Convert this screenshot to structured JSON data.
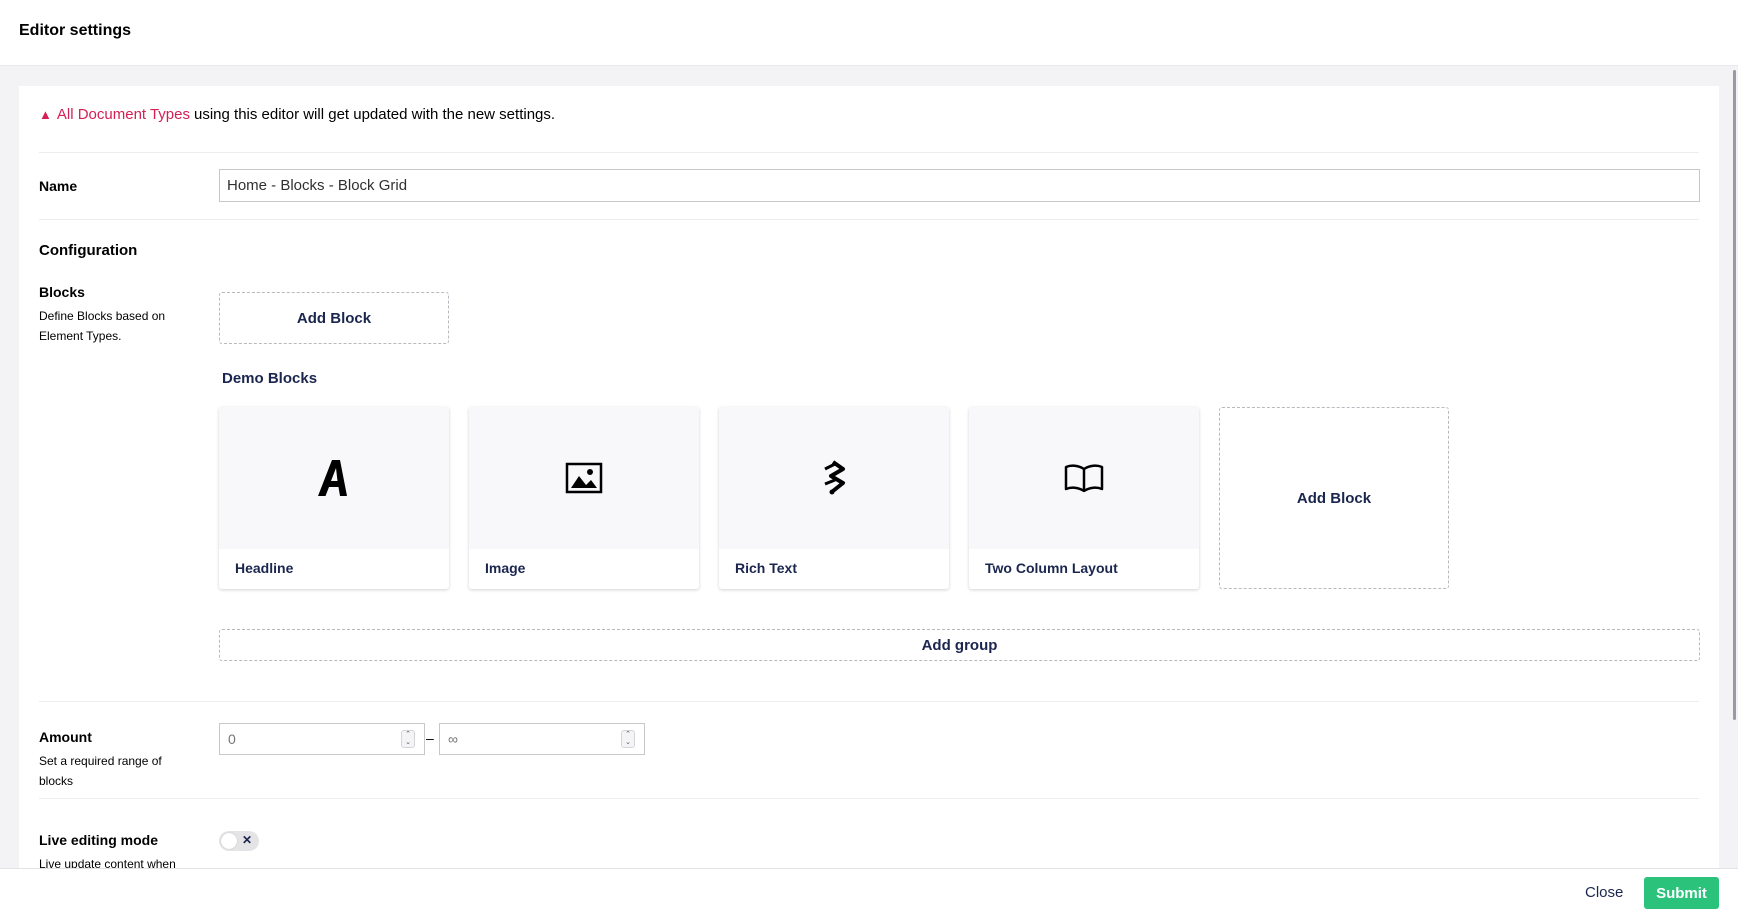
{
  "header": {
    "title": "Editor settings"
  },
  "warning": {
    "icon": "warning-triangle-icon",
    "link_text": "All Document Types",
    "text": "using this editor will get updated with the new settings."
  },
  "name": {
    "label": "Name",
    "value": "Home - Blocks - Block Grid"
  },
  "configuration": {
    "title": "Configuration"
  },
  "blocks": {
    "label": "Blocks",
    "description": "Define Blocks based on Element Types.",
    "add_block_label": "Add Block",
    "group": {
      "name": "Demo Blocks",
      "items": [
        {
          "label": "Headline",
          "icon": "headline-icon"
        },
        {
          "label": "Image",
          "icon": "picture-icon"
        },
        {
          "label": "Rich Text",
          "icon": "rich-text-icon"
        },
        {
          "label": "Two Column Layout",
          "icon": "book-icon"
        }
      ],
      "add_block_label": "Add Block"
    },
    "add_group_label": "Add group"
  },
  "amount": {
    "label": "Amount",
    "description": "Set a required range of blocks",
    "min_placeholder": "0",
    "max_placeholder": "∞",
    "separator": "–"
  },
  "live_editing": {
    "label": "Live editing mode",
    "description": "Live update content when",
    "enabled": false
  },
  "footer": {
    "close_label": "Close",
    "submit_label": "Submit"
  },
  "colors": {
    "accent": "#1b264f",
    "warning": "#d42054",
    "submit": "#2bc37c"
  }
}
